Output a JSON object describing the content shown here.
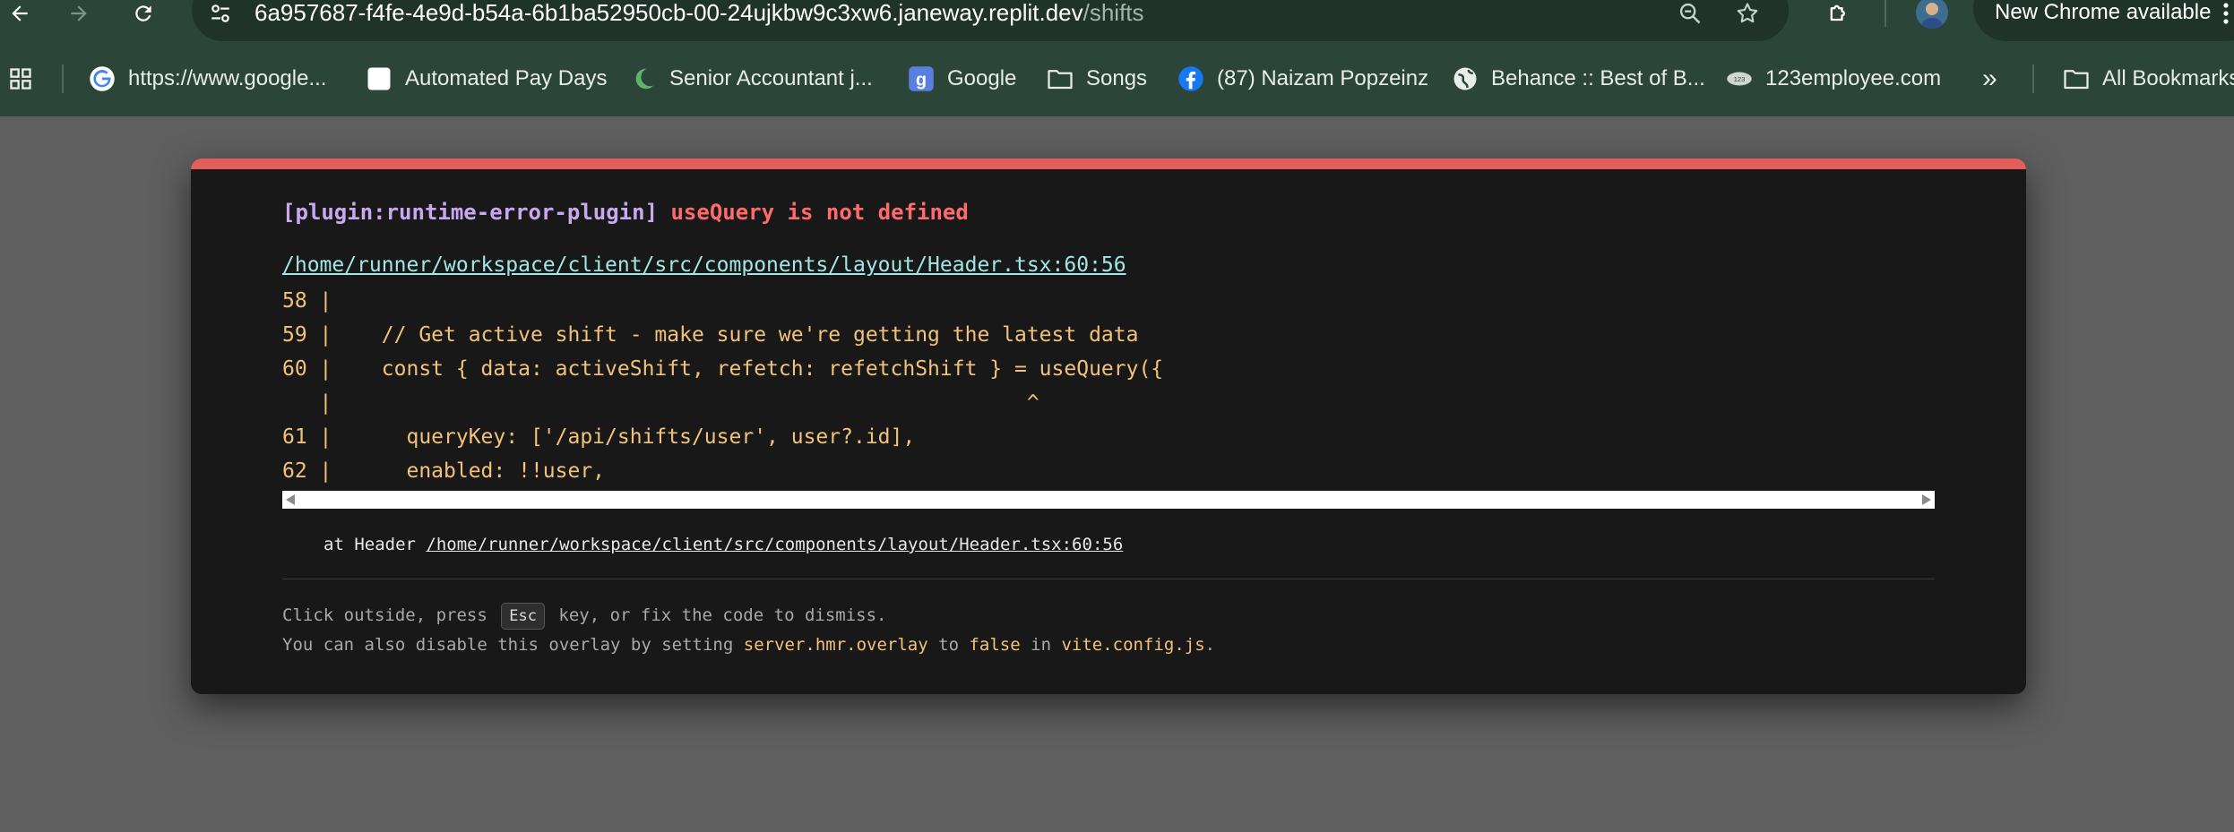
{
  "browser": {
    "url_host": "6a957687-f4fe-4e9d-b54a-6b1ba52950cb-00-24ujkbw9c3xw6.janeway.replit.dev",
    "url_path": "/shifts",
    "update_label": "New Chrome available",
    "bookmarks": [
      {
        "label": "https://www.google...",
        "icon": "google-icon"
      },
      {
        "label": "Automated Pay Days",
        "icon": "page-icon"
      },
      {
        "label": "Senior Accountant j...",
        "icon": "moon-icon"
      },
      {
        "label": "Google",
        "icon": "google-g-icon"
      },
      {
        "label": "Songs",
        "icon": "folder-icon"
      },
      {
        "label": "(87) Naizam Popzeinz",
        "icon": "facebook-icon"
      },
      {
        "label": "Behance :: Best of B...",
        "icon": "globe-icon"
      },
      {
        "label": "123employee.com",
        "icon": "cloud-icon"
      }
    ],
    "all_bookmarks": "All Bookmarks",
    "more_label": "»"
  },
  "overlay": {
    "plugin": "[plugin:runtime-error-plugin]",
    "message": "useQuery is not defined",
    "file": "/home/runner/workspace/client/src/components/layout/Header.tsx:60:56",
    "code_lines": [
      "58 |",
      "59 |    // Get active shift - make sure we're getting the latest data",
      "60 |    const { data: activeShift, refetch: refetchShift } = useQuery({",
      "   |                                                        ^",
      "61 |      queryKey: ['/api/shifts/user', user?.id],",
      "62 |      enabled: !!user,"
    ],
    "stack_prefix": "at Header",
    "stack_file": "/home/runner/workspace/client/src/components/layout/Header.tsx:60:56",
    "tip1_pre": "Click outside, press",
    "tip1_key": "Esc",
    "tip1_post": "key, or fix the code to dismiss.",
    "tip2_pre": "You can also disable this overlay by setting",
    "tip2_code1": "server.hmr.overlay",
    "tip2_mid": "to",
    "tip2_code2": "false",
    "tip2_in": "in",
    "tip2_code3": "vite.config.js",
    "tip2_end": "."
  }
}
